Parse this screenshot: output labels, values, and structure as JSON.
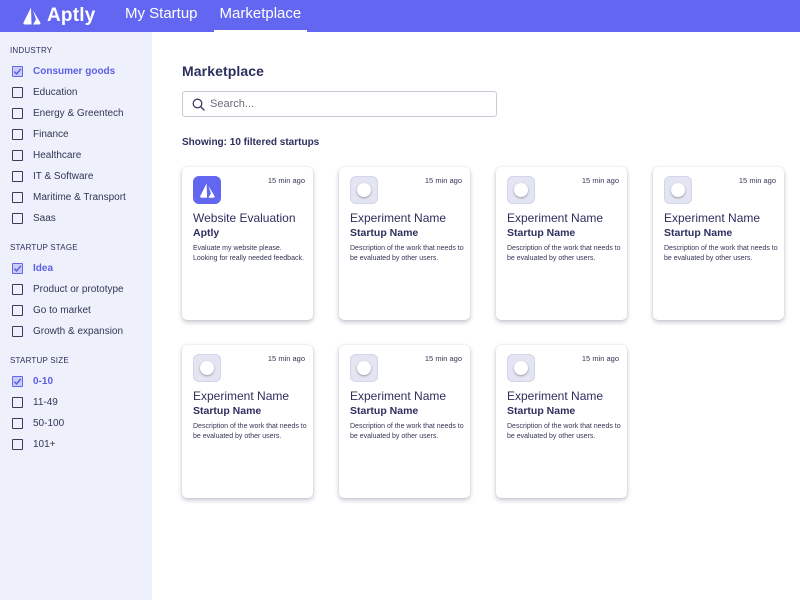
{
  "brand": {
    "name": "Aptly",
    "accent": "#6366f1"
  },
  "nav": [
    {
      "label": "My Startup",
      "active": false
    },
    {
      "label": "Marketplace",
      "active": true
    }
  ],
  "sidebar": {
    "groups": [
      {
        "title": "INDUSTRY",
        "items": [
          {
            "label": "Consumer goods",
            "checked": true
          },
          {
            "label": "Education",
            "checked": false
          },
          {
            "label": "Energy & Greentech",
            "checked": false
          },
          {
            "label": "Finance",
            "checked": false
          },
          {
            "label": "Healthcare",
            "checked": false
          },
          {
            "label": "IT & Software",
            "checked": false
          },
          {
            "label": "Maritime & Transport",
            "checked": false
          },
          {
            "label": "Saas",
            "checked": false
          }
        ]
      },
      {
        "title": "STARTUP STAGE",
        "items": [
          {
            "label": "Idea",
            "checked": true
          },
          {
            "label": "Product or prototype",
            "checked": false
          },
          {
            "label": "Go to market",
            "checked": false
          },
          {
            "label": "Growth & expansion",
            "checked": false
          }
        ]
      },
      {
        "title": "STARTUP SIZE",
        "items": [
          {
            "label": "0-10",
            "checked": true
          },
          {
            "label": "11-49",
            "checked": false
          },
          {
            "label": "50-100",
            "checked": false
          },
          {
            "label": "101+",
            "checked": false
          }
        ]
      }
    ]
  },
  "main": {
    "title": "Marketplace",
    "search": {
      "placeholder": "Search...",
      "value": ""
    },
    "showing": "Showing: 10 filtered startups",
    "cards": [
      {
        "icon": "aptly-logo-icon",
        "time": "15 min ago",
        "title": "Website Evaluation",
        "subtitle": "Aptly",
        "description": "Evaluate my website please. Looking for really needed feedback."
      },
      {
        "icon": "placeholder-icon",
        "time": "15 min ago",
        "title": "Experiment Name",
        "subtitle": "Startup Name",
        "description": "Description of the work that needs to be evaluated by other users."
      },
      {
        "icon": "placeholder-icon",
        "time": "15 min ago",
        "title": "Experiment Name",
        "subtitle": "Startup Name",
        "description": "Description of the work that needs to be evaluated by other users."
      },
      {
        "icon": "placeholder-icon",
        "time": "15 min ago",
        "title": "Experiment Name",
        "subtitle": "Startup Name",
        "description": "Description of the work that needs to be evaluated by other users."
      },
      {
        "icon": "placeholder-icon",
        "time": "15 min ago",
        "title": "Experiment Name",
        "subtitle": "Startup Name",
        "description": "Description of the work that needs to be evaluated by other users."
      },
      {
        "icon": "placeholder-icon",
        "time": "15 min ago",
        "title": "Experiment Name",
        "subtitle": "Startup Name",
        "description": "Description of the work that needs to be evaluated by other users."
      },
      {
        "icon": "placeholder-icon",
        "time": "15 min ago",
        "title": "Experiment Name",
        "subtitle": "Startup Name",
        "description": "Description of the work that needs to be evaluated by other users."
      }
    ]
  }
}
